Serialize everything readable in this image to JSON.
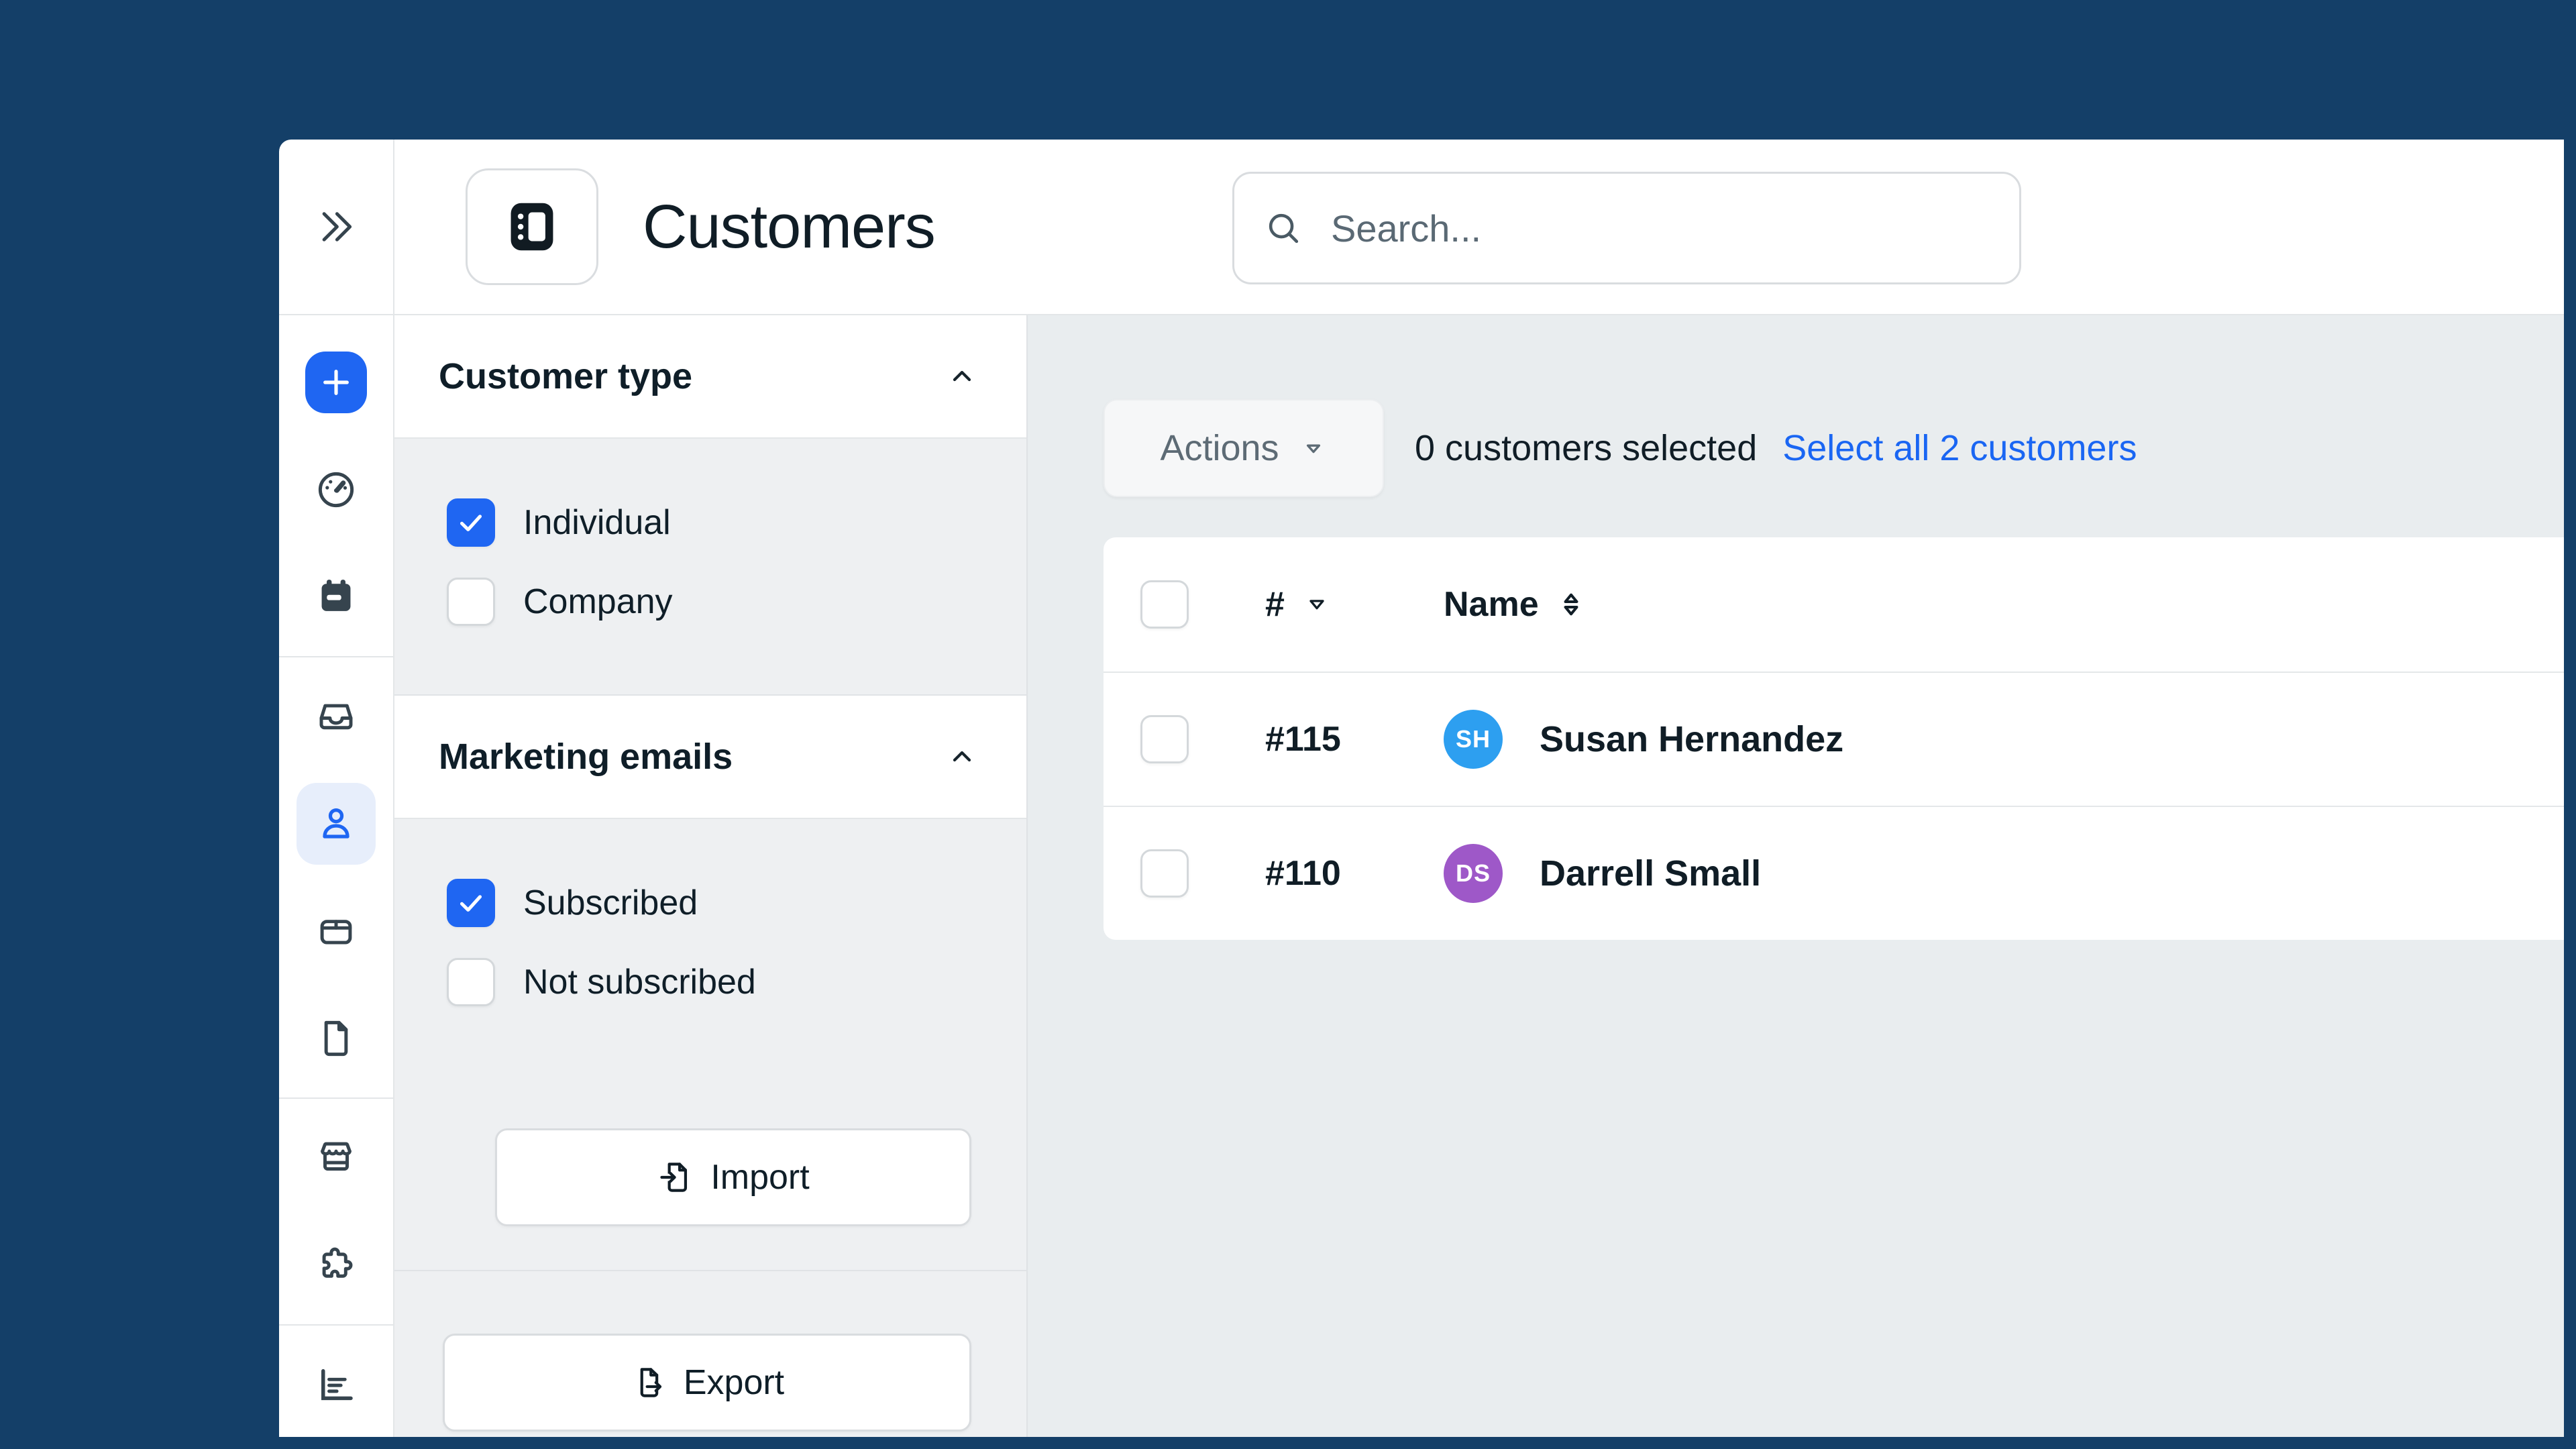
{
  "colors": {
    "frame_navy": "#143f68",
    "accent_blue": "#1f66f2",
    "link_blue": "#1a66f3",
    "avatar_blue": "#2d9ff0",
    "avatar_purple": "#9e58c8"
  },
  "header": {
    "title": "Customers",
    "search_placeholder": "Search..."
  },
  "rail": {
    "icons": [
      "plus",
      "gauge",
      "calendar",
      "inbox-tray",
      "person",
      "case",
      "document",
      "storefront",
      "puzzle",
      "bar-chart"
    ],
    "active": "person"
  },
  "filters": {
    "sections": [
      {
        "title": "Customer type",
        "options": [
          {
            "label": "Individual",
            "checked": true
          },
          {
            "label": "Company",
            "checked": false
          }
        ]
      },
      {
        "title": "Marketing emails",
        "options": [
          {
            "label": "Subscribed",
            "checked": true
          },
          {
            "label": "Not subscribed",
            "checked": false
          }
        ]
      }
    ],
    "import_label": "Import",
    "export_label": "Export"
  },
  "toolbar": {
    "actions_label": "Actions",
    "selected_text": "0 customers selected",
    "select_all_label": "Select all 2 customers"
  },
  "table": {
    "columns": [
      {
        "label": "#",
        "sort": "desc"
      },
      {
        "label": "Name",
        "sort": "both"
      }
    ],
    "rows": [
      {
        "number": "#115",
        "initials": "SH",
        "name": "Susan Hernandez",
        "avatar_color": "#2d9ff0"
      },
      {
        "number": "#110",
        "initials": "DS",
        "name": "Darrell Small",
        "avatar_color": "#9e58c8"
      }
    ]
  }
}
